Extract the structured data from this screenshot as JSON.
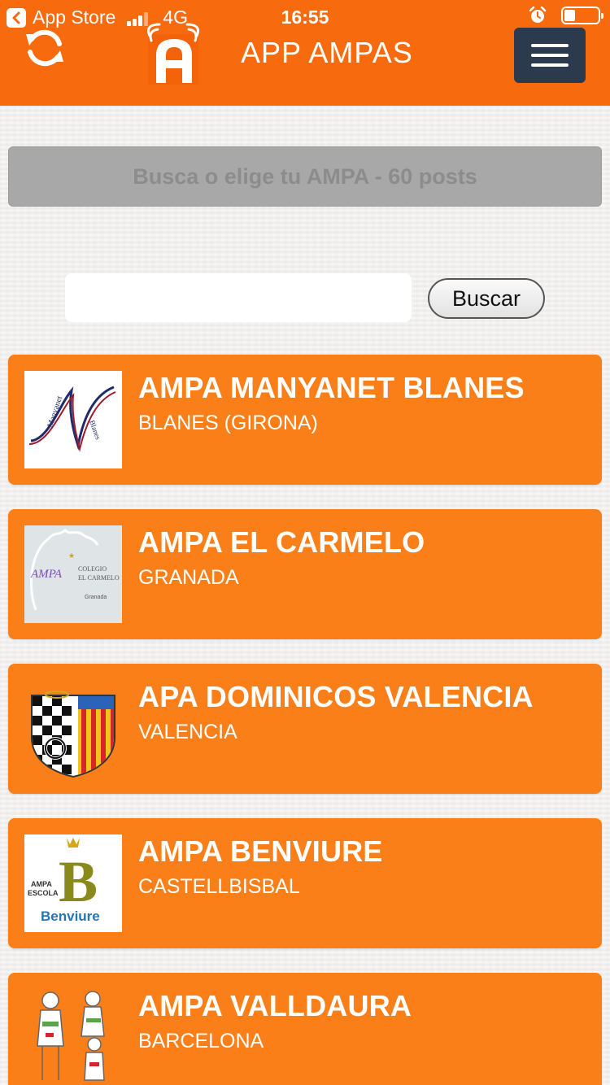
{
  "status_bar": {
    "back_app": "App Store",
    "network": "4G",
    "time": "16:55",
    "icons": [
      "back-chevron-icon",
      "signal-icon",
      "alarm-icon",
      "battery-icon"
    ]
  },
  "header": {
    "title": "APP AMPAS",
    "background": "#f86a0e",
    "menu_button_color": "#2b3a4c",
    "icons": [
      "refresh-icon",
      "app-logo",
      "hamburger-menu-icon"
    ]
  },
  "banner": {
    "text": "Busca o elige tu AMPA - 60 posts"
  },
  "search": {
    "value": "",
    "placeholder": "",
    "button_label": "Buscar"
  },
  "list": {
    "card_color": "#fb7f18",
    "items": [
      {
        "title": "AMPA MANYANET BLANES",
        "subtitle": "BLANES (GIRONA)",
        "logo_text": [
          "Manyanet",
          "Blanes"
        ]
      },
      {
        "title": "AMPA EL CARMELO",
        "subtitle": "GRANADA",
        "logo_text": [
          "AMPA",
          "COLEGIO",
          "EL CARMELO",
          "Granada"
        ]
      },
      {
        "title": "APA DOMINICOS VALENCIA",
        "subtitle": "VALENCIA",
        "logo_text": []
      },
      {
        "title": "AMPA BENVIURE",
        "subtitle": "CASTELLBISBAL",
        "logo_text": [
          "AMPA",
          "ESCOLA",
          "Benviure"
        ]
      },
      {
        "title": "AMPA VALLDAURA",
        "subtitle": "BARCELONA",
        "logo_text": []
      }
    ]
  }
}
